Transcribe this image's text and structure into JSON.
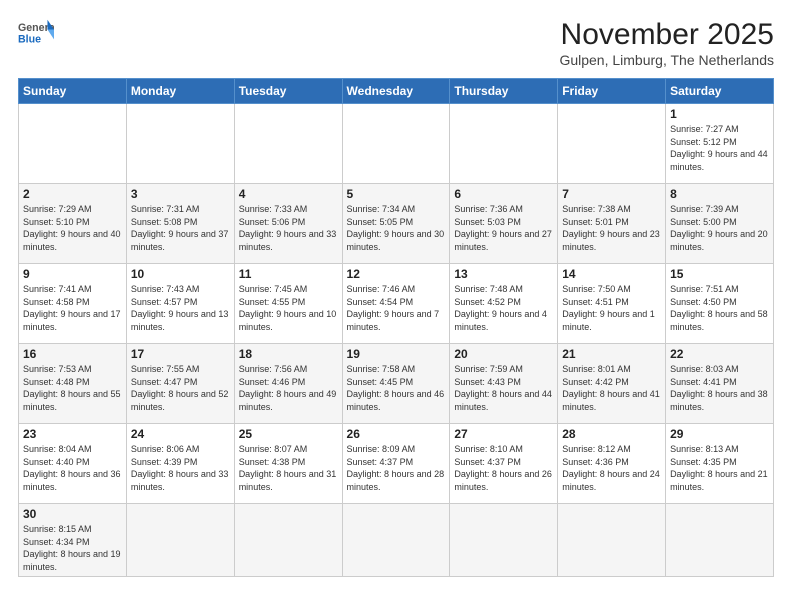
{
  "header": {
    "logo_general": "General",
    "logo_blue": "Blue",
    "title": "November 2025",
    "subtitle": "Gulpen, Limburg, The Netherlands"
  },
  "weekdays": [
    "Sunday",
    "Monday",
    "Tuesday",
    "Wednesday",
    "Thursday",
    "Friday",
    "Saturday"
  ],
  "weeks": [
    {
      "days": [
        {
          "num": "",
          "info": ""
        },
        {
          "num": "",
          "info": ""
        },
        {
          "num": "",
          "info": ""
        },
        {
          "num": "",
          "info": ""
        },
        {
          "num": "",
          "info": ""
        },
        {
          "num": "",
          "info": ""
        },
        {
          "num": "1",
          "info": "Sunrise: 7:27 AM\nSunset: 5:12 PM\nDaylight: 9 hours and 44 minutes."
        }
      ]
    },
    {
      "days": [
        {
          "num": "2",
          "info": "Sunrise: 7:29 AM\nSunset: 5:10 PM\nDaylight: 9 hours and 40 minutes."
        },
        {
          "num": "3",
          "info": "Sunrise: 7:31 AM\nSunset: 5:08 PM\nDaylight: 9 hours and 37 minutes."
        },
        {
          "num": "4",
          "info": "Sunrise: 7:33 AM\nSunset: 5:06 PM\nDaylight: 9 hours and 33 minutes."
        },
        {
          "num": "5",
          "info": "Sunrise: 7:34 AM\nSunset: 5:05 PM\nDaylight: 9 hours and 30 minutes."
        },
        {
          "num": "6",
          "info": "Sunrise: 7:36 AM\nSunset: 5:03 PM\nDaylight: 9 hours and 27 minutes."
        },
        {
          "num": "7",
          "info": "Sunrise: 7:38 AM\nSunset: 5:01 PM\nDaylight: 9 hours and 23 minutes."
        },
        {
          "num": "8",
          "info": "Sunrise: 7:39 AM\nSunset: 5:00 PM\nDaylight: 9 hours and 20 minutes."
        }
      ]
    },
    {
      "days": [
        {
          "num": "9",
          "info": "Sunrise: 7:41 AM\nSunset: 4:58 PM\nDaylight: 9 hours and 17 minutes."
        },
        {
          "num": "10",
          "info": "Sunrise: 7:43 AM\nSunset: 4:57 PM\nDaylight: 9 hours and 13 minutes."
        },
        {
          "num": "11",
          "info": "Sunrise: 7:45 AM\nSunset: 4:55 PM\nDaylight: 9 hours and 10 minutes."
        },
        {
          "num": "12",
          "info": "Sunrise: 7:46 AM\nSunset: 4:54 PM\nDaylight: 9 hours and 7 minutes."
        },
        {
          "num": "13",
          "info": "Sunrise: 7:48 AM\nSunset: 4:52 PM\nDaylight: 9 hours and 4 minutes."
        },
        {
          "num": "14",
          "info": "Sunrise: 7:50 AM\nSunset: 4:51 PM\nDaylight: 9 hours and 1 minute."
        },
        {
          "num": "15",
          "info": "Sunrise: 7:51 AM\nSunset: 4:50 PM\nDaylight: 8 hours and 58 minutes."
        }
      ]
    },
    {
      "days": [
        {
          "num": "16",
          "info": "Sunrise: 7:53 AM\nSunset: 4:48 PM\nDaylight: 8 hours and 55 minutes."
        },
        {
          "num": "17",
          "info": "Sunrise: 7:55 AM\nSunset: 4:47 PM\nDaylight: 8 hours and 52 minutes."
        },
        {
          "num": "18",
          "info": "Sunrise: 7:56 AM\nSunset: 4:46 PM\nDaylight: 8 hours and 49 minutes."
        },
        {
          "num": "19",
          "info": "Sunrise: 7:58 AM\nSunset: 4:45 PM\nDaylight: 8 hours and 46 minutes."
        },
        {
          "num": "20",
          "info": "Sunrise: 7:59 AM\nSunset: 4:43 PM\nDaylight: 8 hours and 44 minutes."
        },
        {
          "num": "21",
          "info": "Sunrise: 8:01 AM\nSunset: 4:42 PM\nDaylight: 8 hours and 41 minutes."
        },
        {
          "num": "22",
          "info": "Sunrise: 8:03 AM\nSunset: 4:41 PM\nDaylight: 8 hours and 38 minutes."
        }
      ]
    },
    {
      "days": [
        {
          "num": "23",
          "info": "Sunrise: 8:04 AM\nSunset: 4:40 PM\nDaylight: 8 hours and 36 minutes."
        },
        {
          "num": "24",
          "info": "Sunrise: 8:06 AM\nSunset: 4:39 PM\nDaylight: 8 hours and 33 minutes."
        },
        {
          "num": "25",
          "info": "Sunrise: 8:07 AM\nSunset: 4:38 PM\nDaylight: 8 hours and 31 minutes."
        },
        {
          "num": "26",
          "info": "Sunrise: 8:09 AM\nSunset: 4:37 PM\nDaylight: 8 hours and 28 minutes."
        },
        {
          "num": "27",
          "info": "Sunrise: 8:10 AM\nSunset: 4:37 PM\nDaylight: 8 hours and 26 minutes."
        },
        {
          "num": "28",
          "info": "Sunrise: 8:12 AM\nSunset: 4:36 PM\nDaylight: 8 hours and 24 minutes."
        },
        {
          "num": "29",
          "info": "Sunrise: 8:13 AM\nSunset: 4:35 PM\nDaylight: 8 hours and 21 minutes."
        }
      ]
    },
    {
      "days": [
        {
          "num": "30",
          "info": "Sunrise: 8:15 AM\nSunset: 4:34 PM\nDaylight: 8 hours and 19 minutes."
        },
        {
          "num": "",
          "info": ""
        },
        {
          "num": "",
          "info": ""
        },
        {
          "num": "",
          "info": ""
        },
        {
          "num": "",
          "info": ""
        },
        {
          "num": "",
          "info": ""
        },
        {
          "num": "",
          "info": ""
        }
      ]
    }
  ]
}
